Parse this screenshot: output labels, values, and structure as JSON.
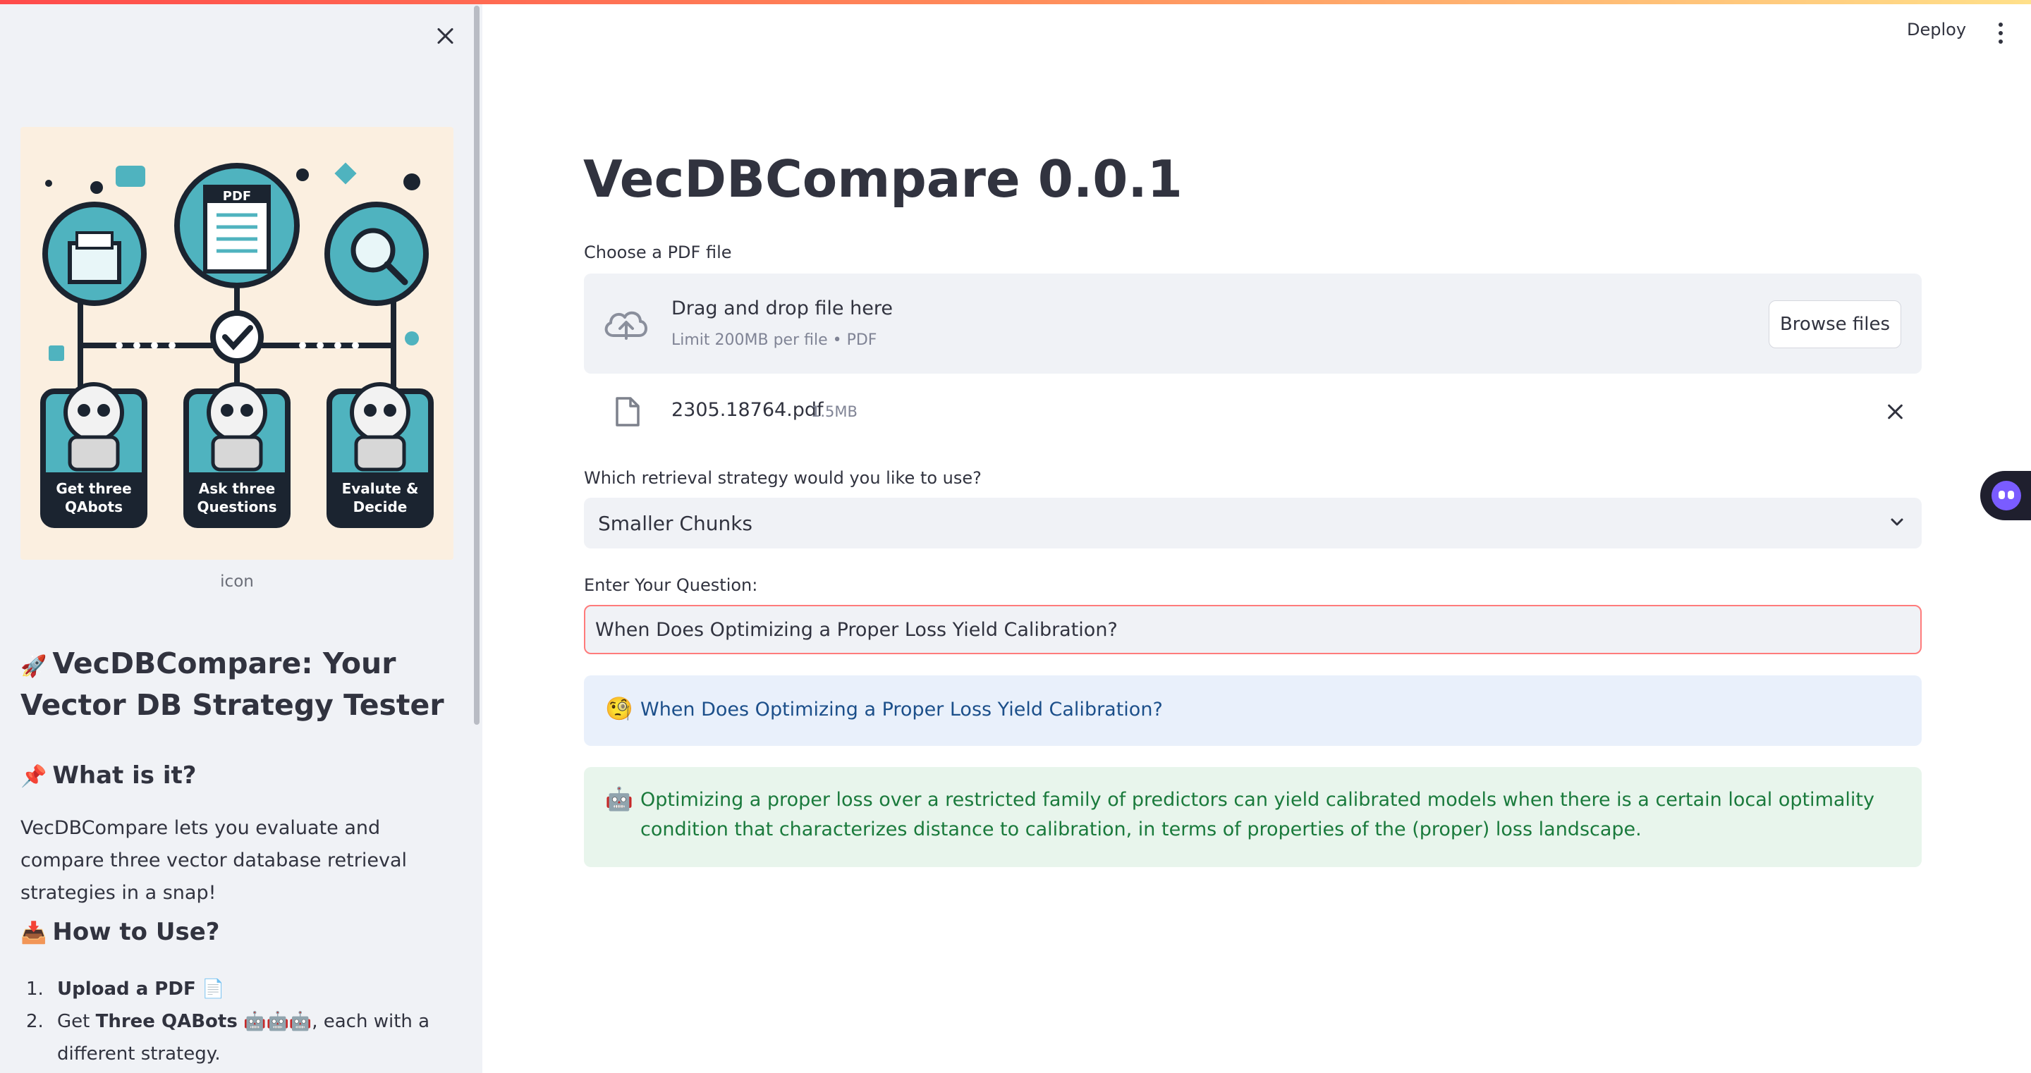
{
  "header": {
    "deploy_label": "Deploy"
  },
  "sidebar": {
    "image_caption": "icon",
    "illustration": {
      "panel1": [
        "Get three",
        "QAbots"
      ],
      "panel2": [
        "Ask three",
        "Questions"
      ],
      "panel3": [
        "Evalute &",
        "Decide"
      ],
      "doc_label": "PDF"
    },
    "title_emoji": "🚀",
    "title": "VecDBCompare: Your Vector DB Strategy Tester",
    "what_emoji": "📌",
    "what_heading": "What is it?",
    "what_text": "VecDBCompare lets you evaluate and compare three vector database retrieval strategies in a snap!",
    "how_emoji": "📥",
    "how_heading": "How to Use?",
    "steps": [
      {
        "num": "1.",
        "bold": "Upload a PDF",
        "emoji": "📄",
        "rest": ""
      },
      {
        "num": "2.",
        "pre": "Get ",
        "bold": "Three QABots",
        "emoji": "🤖🤖🤖",
        "rest": ", each with a different strategy."
      }
    ]
  },
  "main": {
    "title": "VecDBCompare 0.0.1",
    "uploader": {
      "label": "Choose a PDF file",
      "drag_text": "Drag and drop file here",
      "limit_text": "Limit 200MB per file • PDF",
      "browse_label": "Browse files",
      "file_name": "2305.18764.pdf",
      "file_size": "1.5MB"
    },
    "strategy": {
      "label": "Which retrieval strategy would you like to use?",
      "selected": "Smaller Chunks"
    },
    "question": {
      "label": "Enter Your Question:",
      "value": "When Does Optimizing a Proper Loss Yield Calibration?"
    },
    "user_message": {
      "emoji": "🧐",
      "text": "When Does Optimizing a Proper Loss Yield Calibration?"
    },
    "bot_message": {
      "emoji": "🤖",
      "text": "Optimizing a proper loss over a restricted family of predictors can yield calibrated models when there is a certain local optimality condition that characterizes distance to calibration, in terms of properties of the (proper) loss landscape."
    }
  },
  "colors": {
    "accent": "#ff4b4b",
    "sidebar_bg": "#f0f2f6",
    "info_bg": "#e9f0fb",
    "success_bg": "#e8f5ec",
    "illustration_teal": "#4fb3bf"
  }
}
